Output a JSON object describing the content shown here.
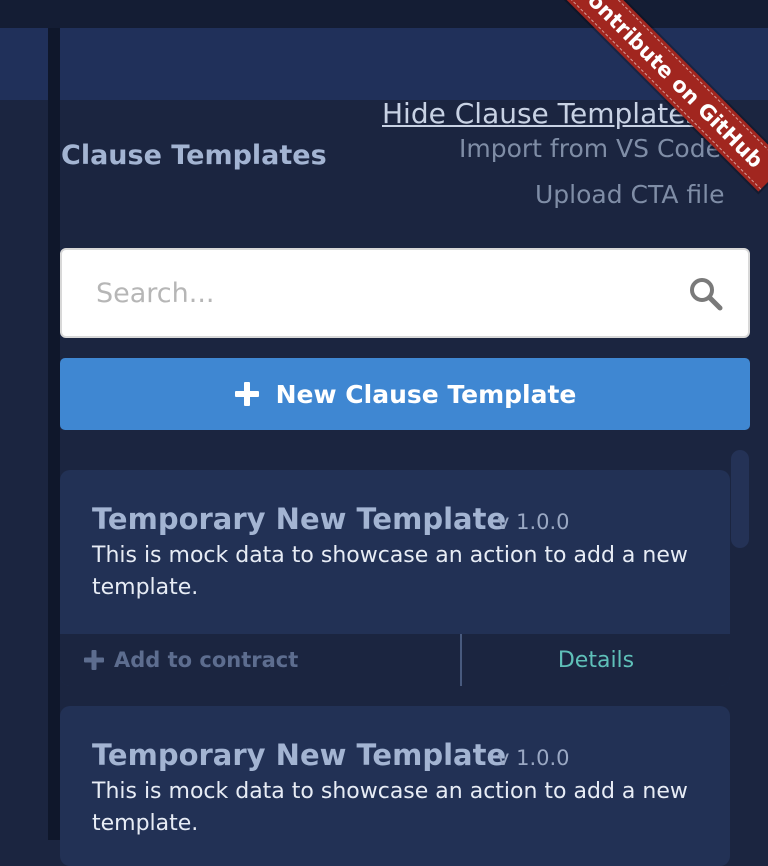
{
  "header": {
    "hide_link": "Hide Clause Templates",
    "import_link": "Import from VS Code",
    "upload_link": "Upload CTA file"
  },
  "panel": {
    "title": "Clause Templates"
  },
  "search": {
    "placeholder": "Search..."
  },
  "new_template_button": {
    "label": "New Clause Template"
  },
  "ribbon": {
    "label": "Contribute on GitHub"
  },
  "templates": [
    {
      "name": "Temporary New Template",
      "version": "v 1.0.0",
      "description": "This is mock data to showcase an action to add a new template.",
      "add_label": "Add to contract",
      "details_label": "Details"
    },
    {
      "name": "Temporary New Template",
      "version": "v 1.0.0",
      "description": "This is mock data to showcase an action to add a new template."
    }
  ],
  "colors": {
    "background": "#1b2540",
    "card": "#223155",
    "primary_button": "#3f87d2",
    "details_link": "#5fc0b9",
    "ribbon": "#a1261f"
  },
  "icons": [
    "search-icon",
    "plus-icon",
    "plus-icon"
  ]
}
